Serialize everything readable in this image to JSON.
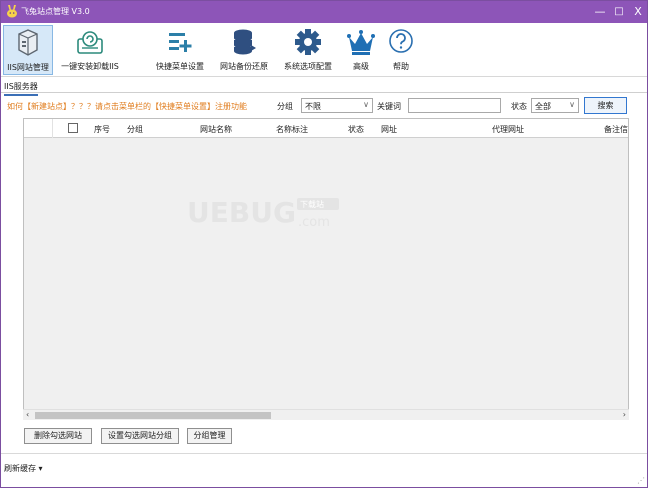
{
  "window": {
    "title": "飞兔站点管理 V3.0",
    "minimize": "—",
    "maximize": "□",
    "close": "X"
  },
  "toolbar": {
    "items": [
      {
        "label": "IIS网站管理",
        "icon": "server-icon"
      },
      {
        "label": "一键安装卸载IIS",
        "icon": "install-icon"
      },
      {
        "label": "快捷菜单设置",
        "icon": "menu-add-icon"
      },
      {
        "label": "网站备份还原",
        "icon": "database-icon"
      },
      {
        "label": "系统选项配置",
        "icon": "gear-icon"
      },
      {
        "label": "高级",
        "icon": "crown-icon"
      },
      {
        "label": "帮助",
        "icon": "help-icon"
      }
    ]
  },
  "tab": {
    "label": "IIS服务器"
  },
  "filter": {
    "hint": "如何【新建站点】？？？请点击菜单栏的【快捷菜单设置】注册功能",
    "group_label": "分组",
    "group_value": "不限",
    "keyword_label": "关键词",
    "keyword_value": "",
    "status_label": "状态",
    "status_value": "全部",
    "search_button": "搜索"
  },
  "table": {
    "columns": [
      "序号",
      "分组",
      "网站名称",
      "名称标注",
      "状态",
      "网址",
      "代理网址",
      "备注信息"
    ],
    "rows": []
  },
  "watermark": {
    "text": "UEBUG",
    "sub": ".com",
    "badge": "下载站"
  },
  "colors": {
    "titlebar": "#8d55b8",
    "hint": "#e07c1d",
    "accent": "#3277d0"
  },
  "actions": {
    "delete": "删除勾选网站",
    "set_group": "设置勾选网站分组",
    "manage_group": "分组管理"
  },
  "status": {
    "label": "刷新缓存 ▾"
  }
}
